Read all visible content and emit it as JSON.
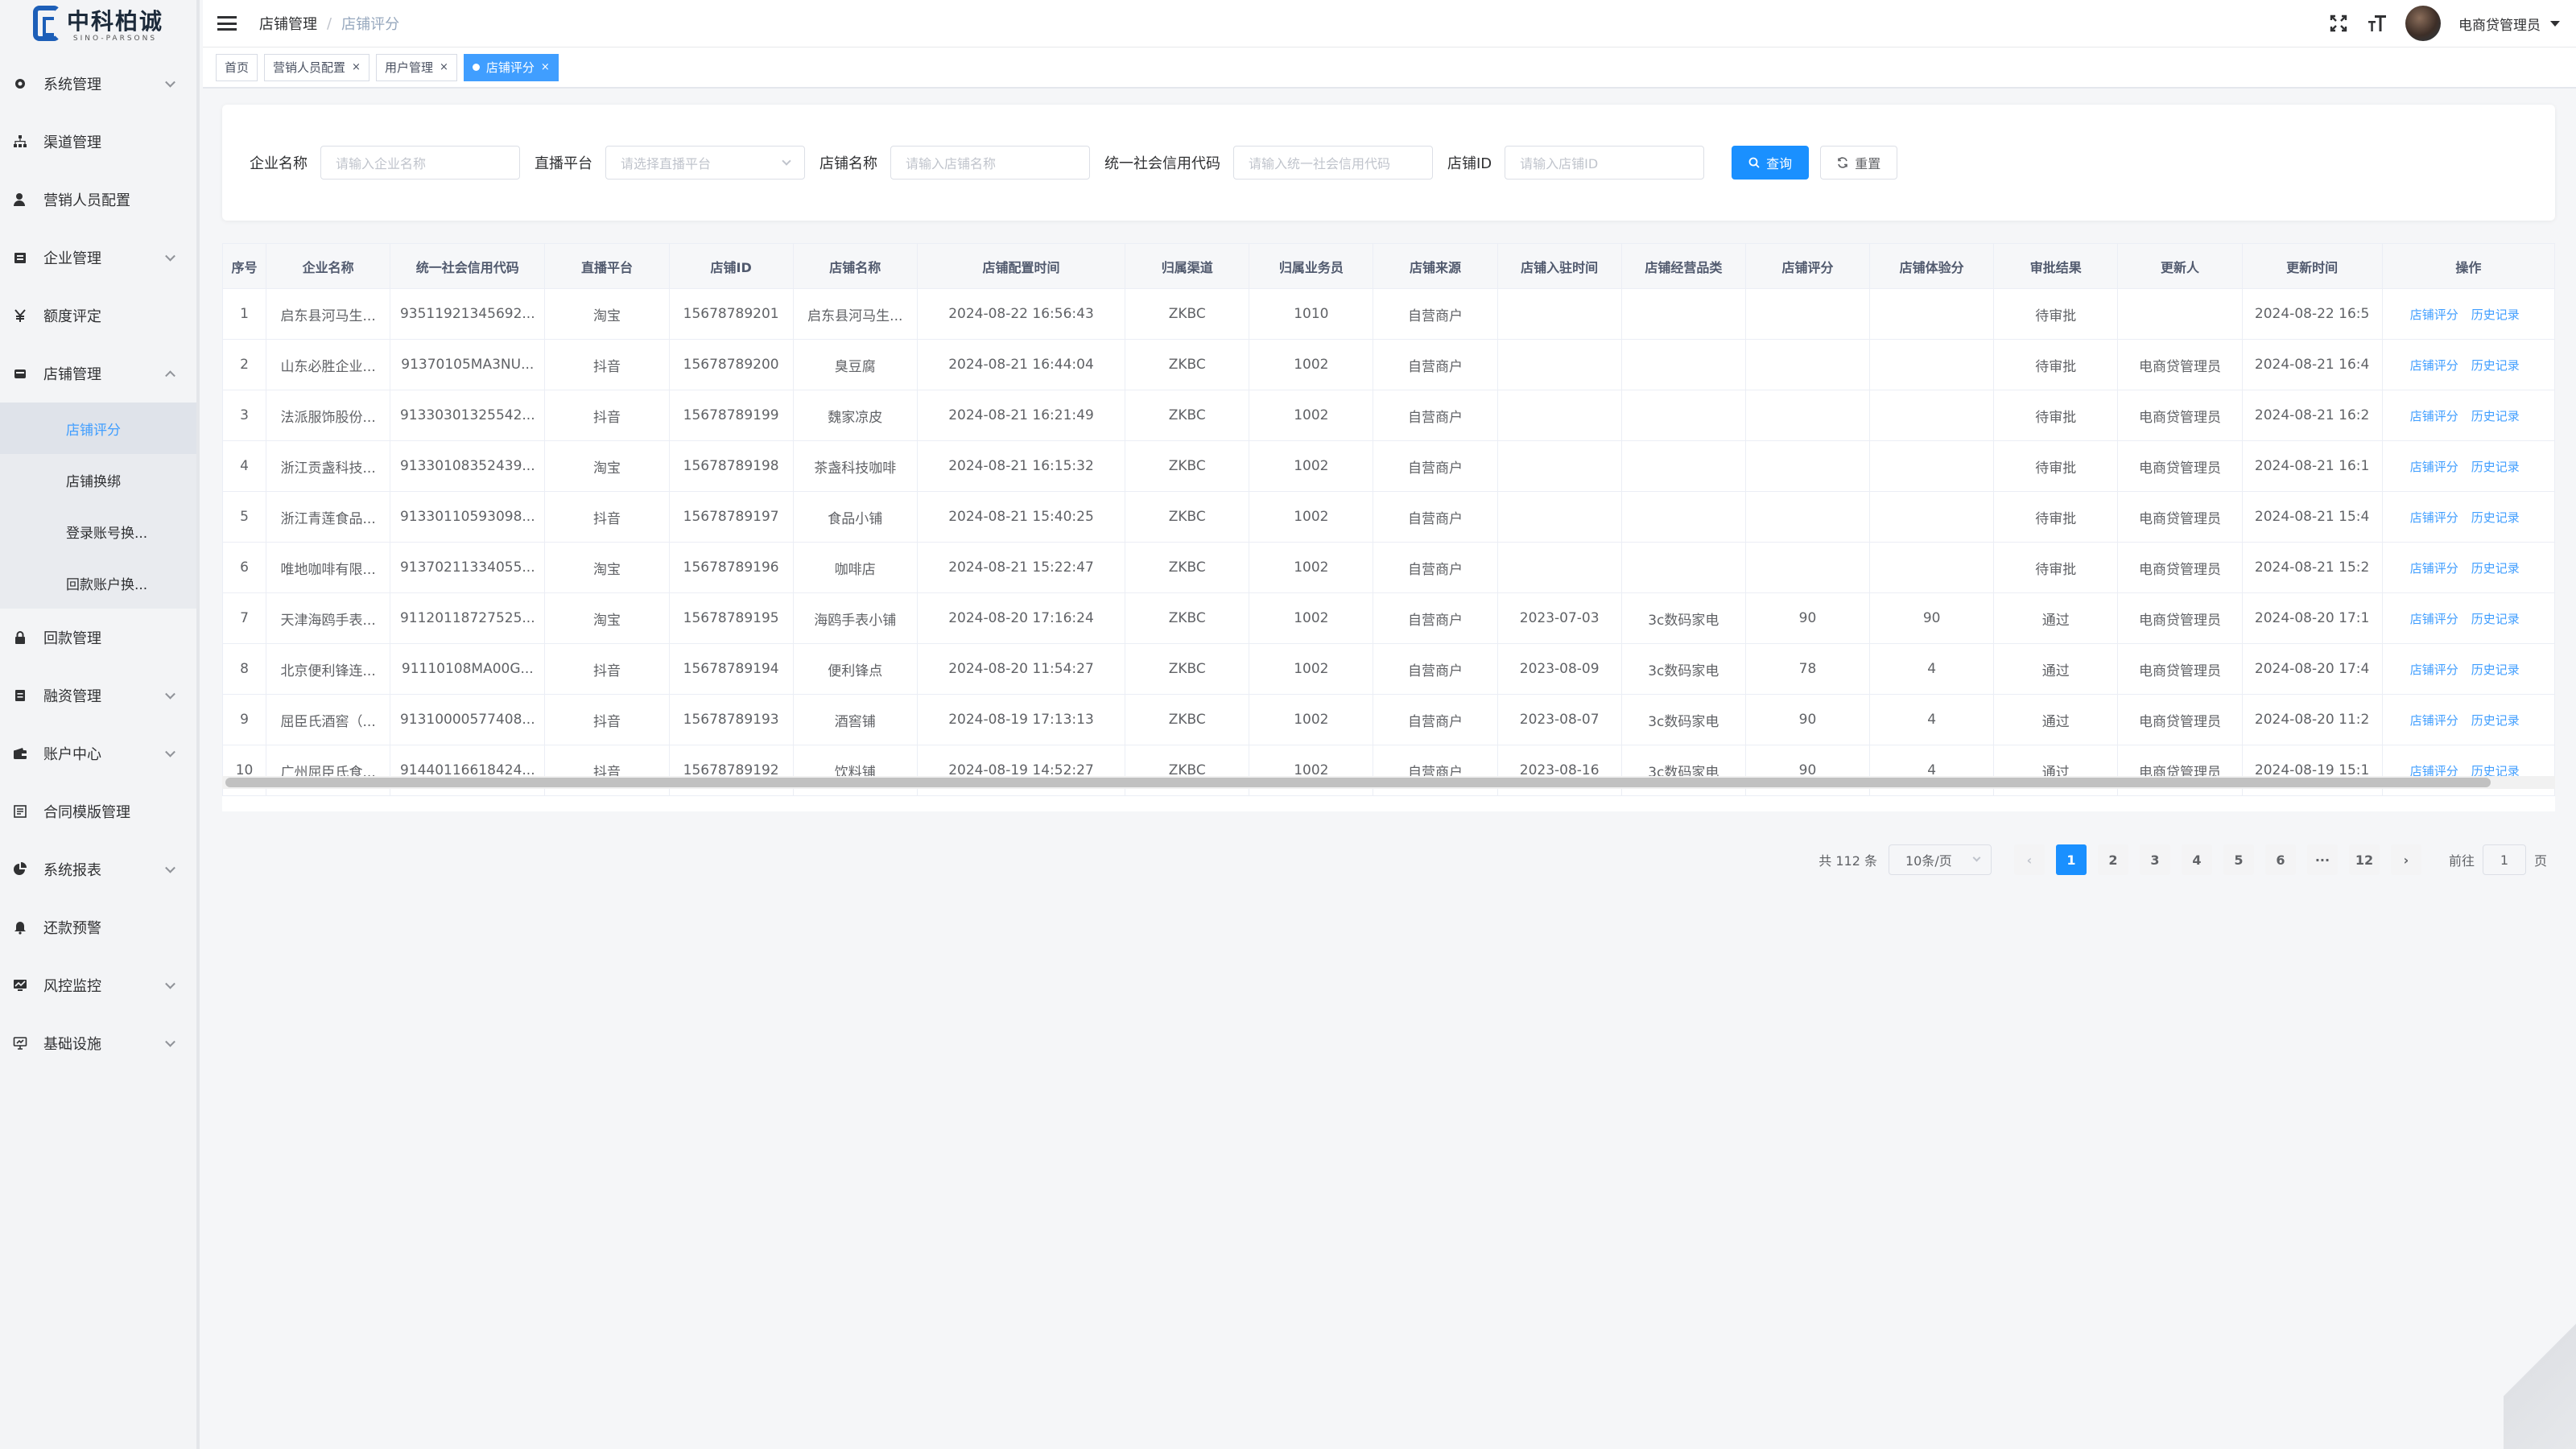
{
  "logo": {
    "cn": "中科柏诚",
    "en": "SINO-PARSONS"
  },
  "sidebar": {
    "items": [
      {
        "label": "系统管理",
        "icon": "gear-icon",
        "expandable": true
      },
      {
        "label": "渠道管理",
        "icon": "hierarchy-icon",
        "expandable": false
      },
      {
        "label": "营销人员配置",
        "icon": "user-icon",
        "expandable": false
      },
      {
        "label": "企业管理",
        "icon": "building-icon",
        "expandable": true
      },
      {
        "label": "额度评定",
        "icon": "yen-icon",
        "expandable": false
      },
      {
        "label": "店铺管理",
        "icon": "shop-icon",
        "expandable": true,
        "open": true
      }
    ],
    "sub_items": [
      {
        "label": "店铺评分",
        "active": true
      },
      {
        "label": "店铺换绑",
        "active": false
      },
      {
        "label": "登录账号换...",
        "active": false
      },
      {
        "label": "回款账户换...",
        "active": false
      }
    ],
    "items_after": [
      {
        "label": "回款管理",
        "icon": "lock-icon",
        "expandable": false
      },
      {
        "label": "融资管理",
        "icon": "document-icon",
        "expandable": true
      },
      {
        "label": "账户中心",
        "icon": "wallet-icon",
        "expandable": true
      },
      {
        "label": "合同模版管理",
        "icon": "contract-icon",
        "expandable": false
      },
      {
        "label": "系统报表",
        "icon": "pie-chart-icon",
        "expandable": true
      },
      {
        "label": "还款预警",
        "icon": "bell-icon",
        "expandable": false
      },
      {
        "label": "风控监控",
        "icon": "monitor-icon",
        "expandable": true
      },
      {
        "label": "基础设施",
        "icon": "screen-icon",
        "expandable": true
      }
    ]
  },
  "header": {
    "breadcrumb": [
      "店铺管理",
      "店铺评分"
    ],
    "user_name": "电商贷管理员"
  },
  "tags": [
    {
      "label": "首页",
      "closable": false,
      "active": false
    },
    {
      "label": "营销人员配置",
      "closable": true,
      "active": false
    },
    {
      "label": "用户管理",
      "closable": true,
      "active": false
    },
    {
      "label": "店铺评分",
      "closable": true,
      "active": true
    }
  ],
  "search": {
    "fields": [
      {
        "label": "企业名称",
        "placeholder": "请输入企业名称",
        "type": "input"
      },
      {
        "label": "直播平台",
        "placeholder": "请选择直播平台",
        "type": "select"
      },
      {
        "label": "店铺名称",
        "placeholder": "请输入店铺名称",
        "type": "input"
      },
      {
        "label": "统一社会信用代码",
        "placeholder": "请输入统一社会信用代码",
        "type": "input"
      },
      {
        "label": "店铺ID",
        "placeholder": "请输入店铺ID",
        "type": "input"
      }
    ],
    "query_label": "查询",
    "reset_label": "重置"
  },
  "table": {
    "columns": [
      "序号",
      "企业名称",
      "统一社会信用代码",
      "直播平台",
      "店铺ID",
      "店铺名称",
      "店铺配置时间",
      "归属渠道",
      "归属业务员",
      "店铺来源",
      "店铺入驻时间",
      "店铺经营品类",
      "店铺评分",
      "店铺体验分",
      "审批结果",
      "更新人",
      "更新时间",
      "操作"
    ],
    "op_labels": [
      "店铺评分",
      "历史记录"
    ],
    "rows": [
      [
        "1",
        "启东县河马生...",
        "93511921345692...",
        "淘宝",
        "15678789201",
        "启东县河马生...",
        "2024-08-22 16:56:43",
        "ZKBC",
        "1010",
        "自营商户",
        "",
        "",
        "",
        "",
        "待审批",
        "",
        "2024-08-22 16:5"
      ],
      [
        "2",
        "山东必胜企业...",
        "91370105MA3NU...",
        "抖音",
        "15678789200",
        "臭豆腐",
        "2024-08-21 16:44:04",
        "ZKBC",
        "1002",
        "自营商户",
        "",
        "",
        "",
        "",
        "待审批",
        "电商贷管理员",
        "2024-08-21 16:4"
      ],
      [
        "3",
        "法派服饰股份...",
        "91330301325542...",
        "抖音",
        "15678789199",
        "魏家凉皮",
        "2024-08-21 16:21:49",
        "ZKBC",
        "1002",
        "自营商户",
        "",
        "",
        "",
        "",
        "待审批",
        "电商贷管理员",
        "2024-08-21 16:2"
      ],
      [
        "4",
        "浙江贡盏科技...",
        "91330108352439...",
        "淘宝",
        "15678789198",
        "茶盏科技咖啡",
        "2024-08-21 16:15:32",
        "ZKBC",
        "1002",
        "自营商户",
        "",
        "",
        "",
        "",
        "待审批",
        "电商贷管理员",
        "2024-08-21 16:1"
      ],
      [
        "5",
        "浙江青莲食品...",
        "91330110593098...",
        "抖音",
        "15678789197",
        "食品小铺",
        "2024-08-21 15:40:25",
        "ZKBC",
        "1002",
        "自营商户",
        "",
        "",
        "",
        "",
        "待审批",
        "电商贷管理员",
        "2024-08-21 15:4"
      ],
      [
        "6",
        "唯地咖啡有限...",
        "91370211334055...",
        "淘宝",
        "15678789196",
        "咖啡店",
        "2024-08-21 15:22:47",
        "ZKBC",
        "1002",
        "自营商户",
        "",
        "",
        "",
        "",
        "待审批",
        "电商贷管理员",
        "2024-08-21 15:2"
      ],
      [
        "7",
        "天津海鸥手表...",
        "91120118727525...",
        "淘宝",
        "15678789195",
        "海鸥手表小铺",
        "2024-08-20 17:16:24",
        "ZKBC",
        "1002",
        "自营商户",
        "2023-07-03",
        "3c数码家电",
        "90",
        "90",
        "通过",
        "电商贷管理员",
        "2024-08-20 17:1"
      ],
      [
        "8",
        "北京便利锋连...",
        "91110108MA00G...",
        "抖音",
        "15678789194",
        "便利锋点",
        "2024-08-20 11:54:27",
        "ZKBC",
        "1002",
        "自营商户",
        "2023-08-09",
        "3c数码家电",
        "78",
        "4",
        "通过",
        "电商贷管理员",
        "2024-08-20 17:4"
      ],
      [
        "9",
        "屈臣氏酒窖（...",
        "91310000577408...",
        "抖音",
        "15678789193",
        "酒窖铺",
        "2024-08-19 17:13:13",
        "ZKBC",
        "1002",
        "自营商户",
        "2023-08-07",
        "3c数码家电",
        "90",
        "4",
        "通过",
        "电商贷管理员",
        "2024-08-20 11:2"
      ],
      [
        "10",
        "广州屈臣氏食...",
        "91440116618424...",
        "抖音",
        "15678789192",
        "饮料铺",
        "2024-08-19 14:52:27",
        "ZKBC",
        "1002",
        "自营商户",
        "2023-08-16",
        "3c数码家电",
        "90",
        "4",
        "通过",
        "电商贷管理员",
        "2024-08-19 15:1"
      ]
    ]
  },
  "pagination": {
    "total_text": "共 112 条",
    "page_size": "10条/页",
    "pages": [
      "1",
      "2",
      "3",
      "4",
      "5",
      "6",
      "···",
      "12"
    ],
    "current": "1",
    "goto_prefix": "前往",
    "goto_value": "1",
    "goto_suffix": "页"
  },
  "colors": {
    "primary": "#1a90ff",
    "link": "#409eff",
    "sidebar_bg": "#f3f4f6"
  }
}
